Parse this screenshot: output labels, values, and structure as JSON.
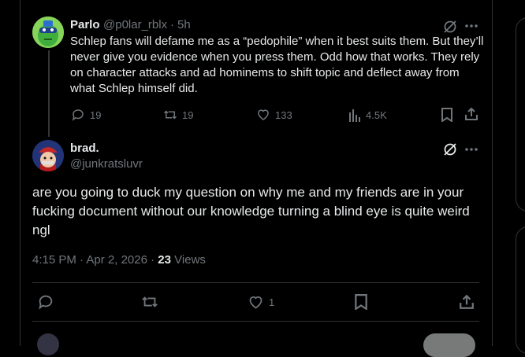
{
  "reply": {
    "author_name": "Parlo",
    "handle": "@p0lar_rblx",
    "separator": "·",
    "time": "5h",
    "text": "Schlep fans will defame me as a “pedophile” when it best suits them. But they’ll never give you evidence when you press them. Odd how that works. They rely on character attacks and ad hominems to shift topic and deflect away from what Schlep himself did.",
    "replies": "19",
    "reposts": "19",
    "likes": "133",
    "views": "4.5K"
  },
  "main_post": {
    "author_name": "brad.",
    "handle": "@junkratsluvr",
    "text": "are you going to duck my question on why me and my friends are in your fucking document without our knowledge turning a blind eye is quite weird ngl",
    "time": "4:15 PM",
    "sep1": "·",
    "date": "Apr 2, 2026",
    "sep2": "·",
    "views_count": "23",
    "views_label": "Views",
    "likes": "1"
  },
  "colors": {
    "background": "#000000",
    "text": "#e7e9ea",
    "muted": "#71767b",
    "border": "#2f3336"
  }
}
